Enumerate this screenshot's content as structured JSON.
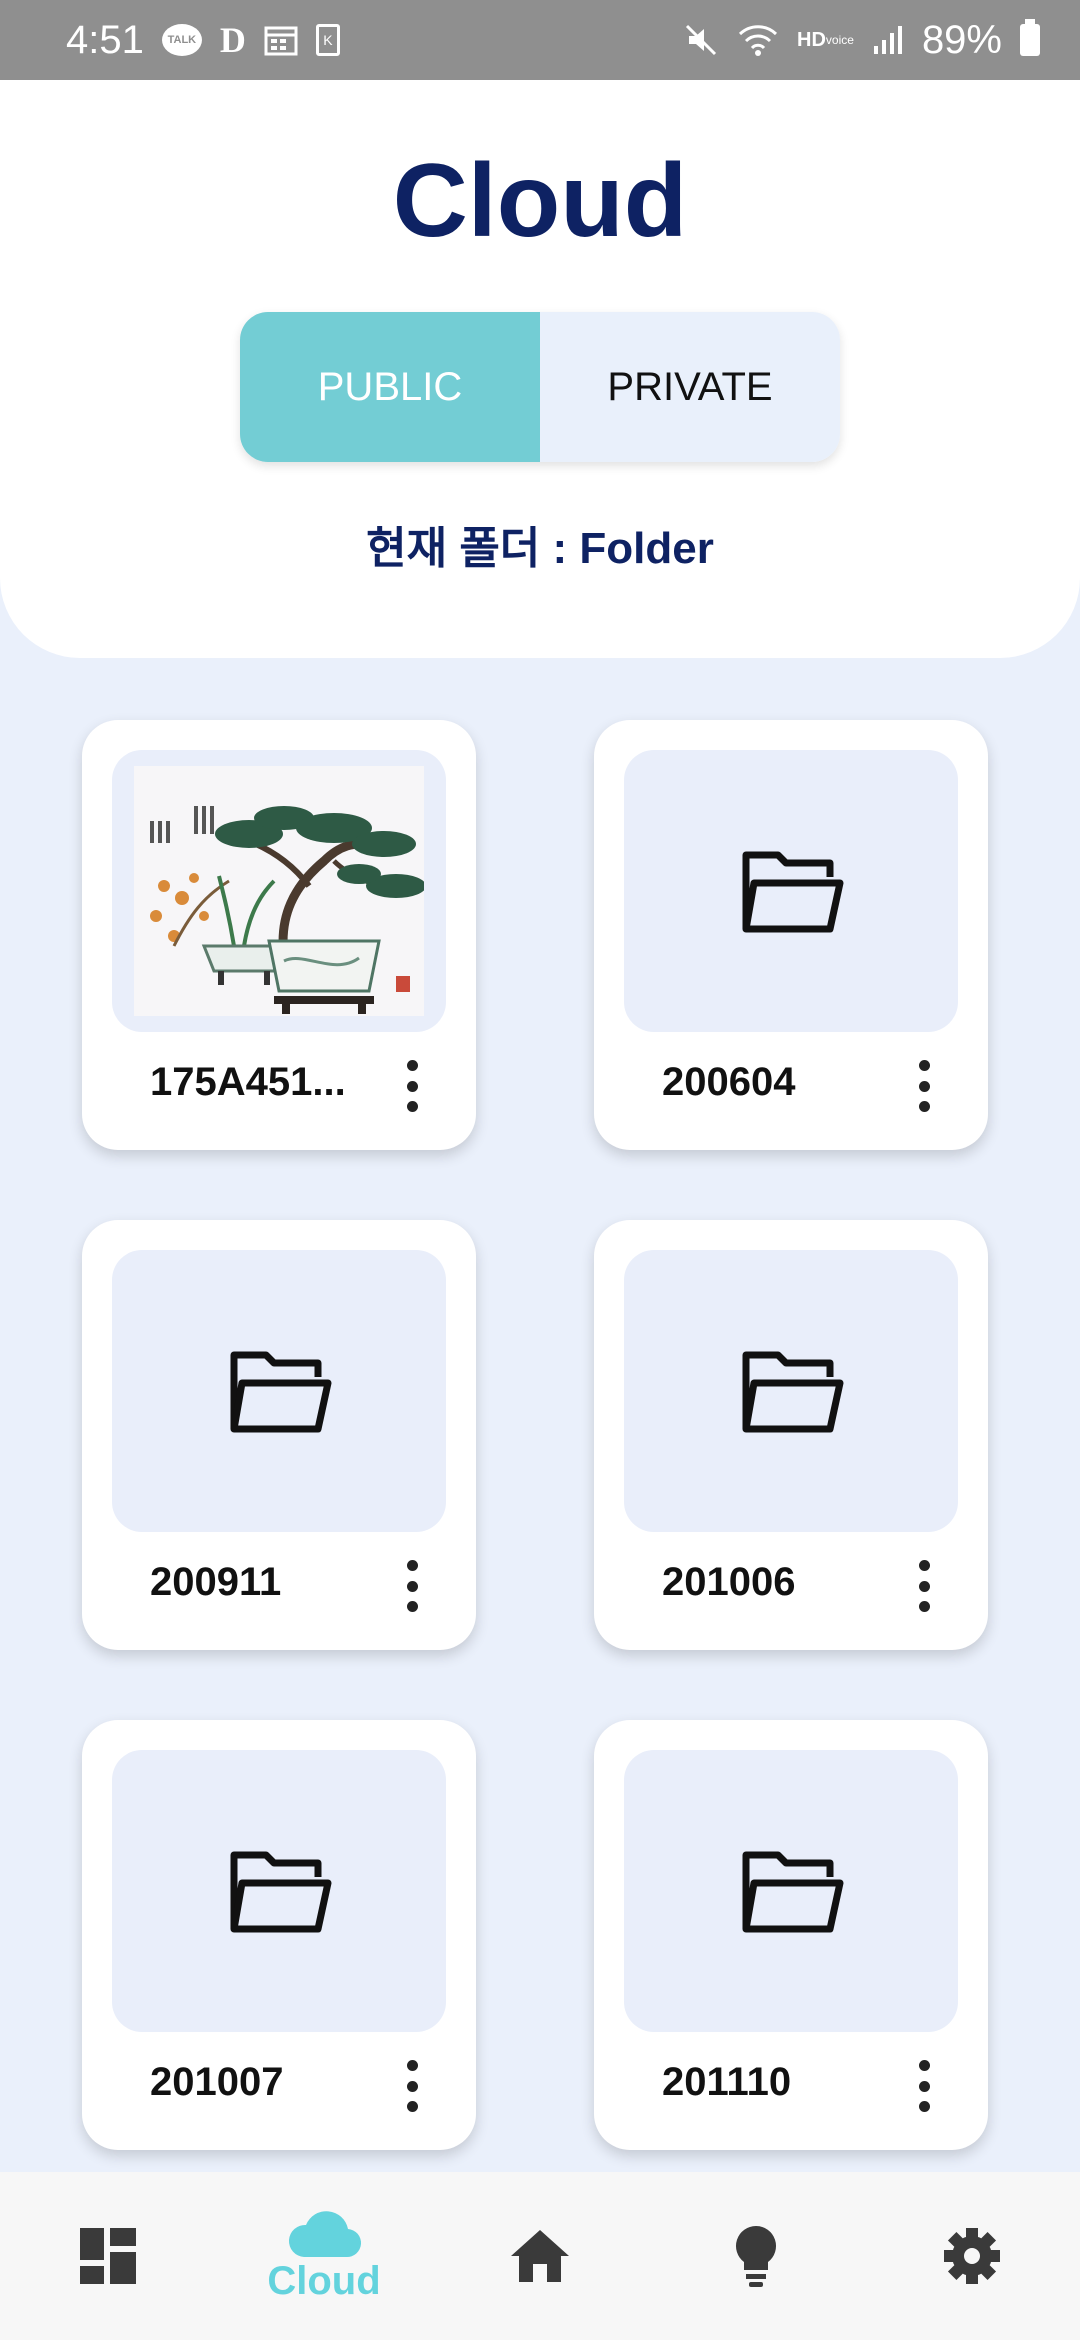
{
  "status_bar": {
    "time": "4:51",
    "talk_label": "TALK",
    "d_label": "D",
    "k_label": "K",
    "hd_label": "HD",
    "voice_label": "voice",
    "battery": "89%"
  },
  "header": {
    "title": "Cloud",
    "tabs": [
      {
        "label": "PUBLIC",
        "selected": true
      },
      {
        "label": "PRIVATE",
        "selected": false
      }
    ],
    "current_folder": "현재 폴더 : Folder"
  },
  "items": [
    {
      "name": "175A451...",
      "type": "image",
      "icon": "bonsai-image"
    },
    {
      "name": "200604",
      "type": "folder",
      "icon": "folder-open-icon"
    },
    {
      "name": "200911",
      "type": "folder",
      "icon": "folder-open-icon"
    },
    {
      "name": "201006",
      "type": "folder",
      "icon": "folder-open-icon"
    },
    {
      "name": "201007",
      "type": "folder",
      "icon": "folder-open-icon"
    },
    {
      "name": "201110",
      "type": "folder",
      "icon": "folder-open-icon"
    }
  ],
  "bottom_nav": {
    "items": [
      {
        "icon": "dashboard-icon",
        "label": ""
      },
      {
        "icon": "cloud-icon",
        "label": "Cloud",
        "active": true
      },
      {
        "icon": "home-icon",
        "label": ""
      },
      {
        "icon": "lightbulb-icon",
        "label": ""
      },
      {
        "icon": "gear-icon",
        "label": ""
      }
    ]
  },
  "colors": {
    "title": "#0e2263",
    "accent": "#73cdd4",
    "nav_active": "#63d3dd",
    "background": "#eaf0fb"
  }
}
